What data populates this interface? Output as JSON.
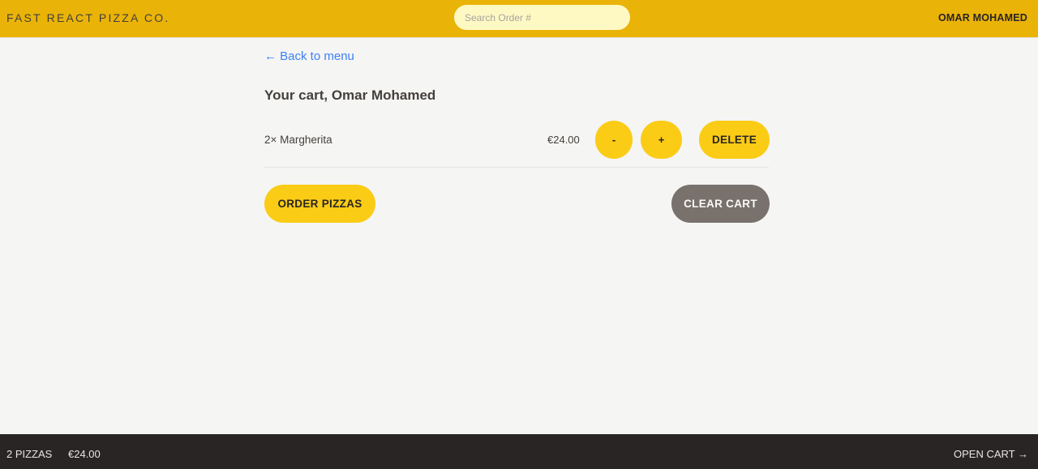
{
  "header": {
    "logo": "Fast React Pizza Co.",
    "search_placeholder": "Search Order #",
    "username": "Omar Mohamed"
  },
  "main": {
    "back_link": "← Back to menu",
    "cart_title": "Your cart, Omar Mohamed",
    "items": [
      {
        "name": "2× Margherita",
        "price": "€24.00",
        "decrease_label": "-",
        "increase_label": "+",
        "delete_label": "Delete"
      }
    ],
    "order_button": "Order pizzas",
    "clear_button": "Clear cart"
  },
  "footer": {
    "pizza_count": "2 pizzas",
    "total": "€24.00",
    "open_cart": "Open cart →"
  },
  "colors": {
    "header_bg": "#eab308",
    "button_primary": "#facc15",
    "button_secondary": "#78716c",
    "footer_bg": "#292524",
    "link": "#3b82f6"
  }
}
